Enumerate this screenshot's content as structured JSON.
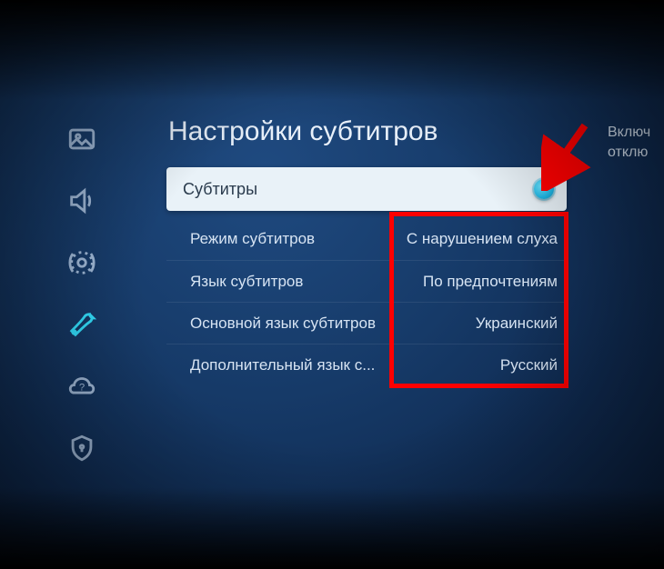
{
  "title": "Настройки субтитров",
  "subtitle_toggle": {
    "label": "Субтитры",
    "state": "on"
  },
  "rows": [
    {
      "label": "Режим субтитров",
      "value": "С нарушением слуха"
    },
    {
      "label": "Язык субтитров",
      "value": "По предпочтениям"
    },
    {
      "label": "Основной язык субтитров",
      "value": "Украинский"
    },
    {
      "label": "Дополнительный язык с...",
      "value": "Русский"
    }
  ],
  "side_note": {
    "line1": "Включ",
    "line2": "отклю"
  },
  "sidebar_icons": [
    "picture-icon",
    "sound-icon",
    "broadcast-icon",
    "general-icon",
    "support-icon",
    "privacy-icon"
  ],
  "active_sidebar_index": 3,
  "annotation": {
    "arrow_color": "#ff0000",
    "highlight_color": "#ff0000"
  }
}
